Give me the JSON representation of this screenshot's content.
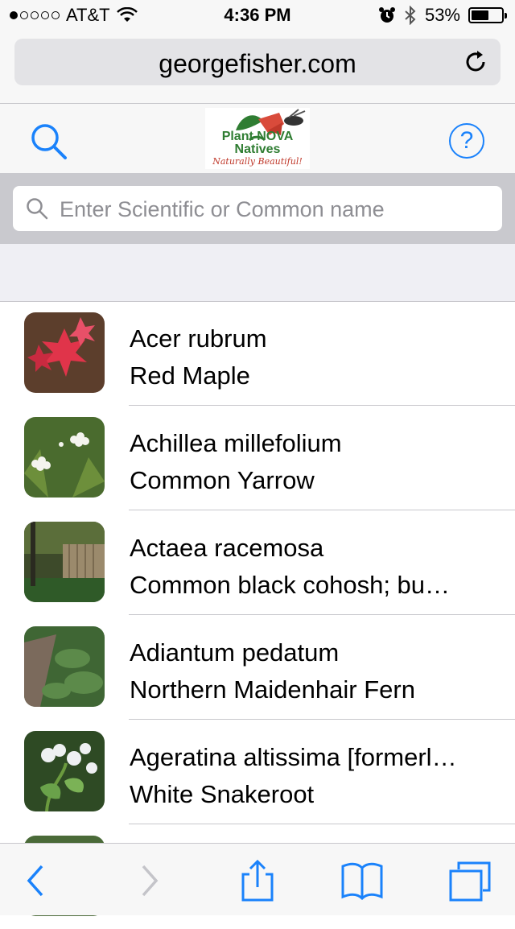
{
  "status_bar": {
    "carrier": "AT&T",
    "signal_dots": 1,
    "time": "4:36 PM",
    "battery": "53%",
    "battery_level": 0.53
  },
  "browser": {
    "url": "georgefisher.com"
  },
  "app_header": {
    "logo_text": "Plant NOVA Natives",
    "logo_tagline": "Naturally Beautiful!",
    "help_label": "?"
  },
  "search": {
    "placeholder": "Enter Scientific or Common name"
  },
  "plants": [
    {
      "scientific": "Acer rubrum",
      "common": "Red Maple",
      "thumb": "red maple leaves"
    },
    {
      "scientific": "Achillea millefolium",
      "common": "Common Yarrow",
      "thumb": "white yarrow flowers"
    },
    {
      "scientific": "Actaea racemosa",
      "common": "Common black cohosh; bu…",
      "thumb": "woodland fence"
    },
    {
      "scientific": "Adiantum pedatum",
      "common": "Northern Maidenhair Fern",
      "thumb": "fern groundcover"
    },
    {
      "scientific": "Ageratina altissima [formerl…",
      "common": "White Snakeroot",
      "thumb": "white flower clusters"
    }
  ],
  "colors": {
    "accent": "#1a82fb",
    "toolbar_bg": "#f7f7f7",
    "search_band": "#c9c9ce"
  }
}
